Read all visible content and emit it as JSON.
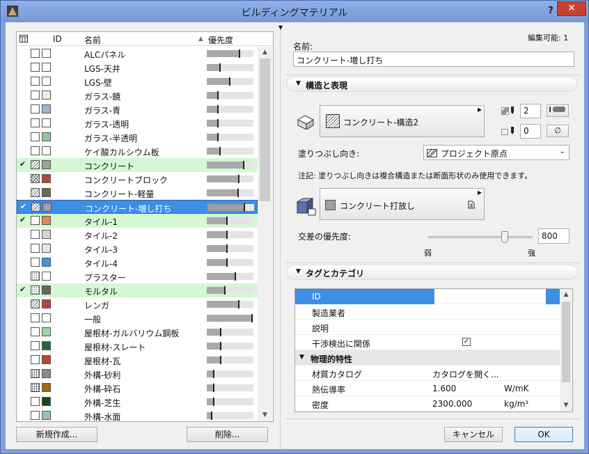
{
  "window": {
    "title": "ビルディングマテリアル",
    "help": "?",
    "close": "✕"
  },
  "list": {
    "headers": {
      "id": "ID",
      "name": "名前",
      "priority": "優先度",
      "sort_arrow": "▲"
    },
    "rows": [
      {
        "name": "ALCパネル",
        "check": "",
        "p1": "empty",
        "c2": "#ffffff",
        "priority": 0.72,
        "state": ""
      },
      {
        "name": "LGS-天井",
        "check": "",
        "p1": "empty",
        "c2": "#ffffff",
        "priority": 0.3,
        "state": ""
      },
      {
        "name": "LGS-壁",
        "check": "",
        "p1": "empty",
        "c2": "#ffffff",
        "priority": 0.5,
        "state": ""
      },
      {
        "name": "ガラス-鏡",
        "check": "",
        "p1": "empty",
        "c2": "#e8f0e0",
        "priority": 0.25,
        "state": ""
      },
      {
        "name": "ガラス-青",
        "check": "",
        "p1": "empty",
        "c2": "#9eb6d6",
        "priority": 0.25,
        "state": ""
      },
      {
        "name": "ガラス-透明",
        "check": "",
        "p1": "empty",
        "c2": "#ffffff",
        "priority": 0.25,
        "state": ""
      },
      {
        "name": "ガラス-半透明",
        "check": "",
        "p1": "empty",
        "c2": "#8fc79a",
        "priority": 0.25,
        "state": ""
      },
      {
        "name": "ケイ酸カルシウム板",
        "check": "",
        "p1": "empty",
        "c2": "#ffffff",
        "priority": 0.3,
        "state": ""
      },
      {
        "name": "コンクリート",
        "check": "✔",
        "p1": "hatch",
        "c2": "#a0a0a0",
        "priority": 0.8,
        "state": "green"
      },
      {
        "name": "コンクリートブロック",
        "check": "",
        "p1": "cross",
        "c2": "#b5483a",
        "priority": 0.7,
        "state": ""
      },
      {
        "name": "コンクリート-軽量",
        "check": "",
        "p1": "hatch",
        "c2": "#6a6a50",
        "priority": 0.68,
        "state": ""
      },
      {
        "name": "コンクリート-増し打ち",
        "check": "✔",
        "p1": "hatch",
        "c2": "#a0a0a0",
        "priority": 0.8,
        "state": "sel"
      },
      {
        "name": "タイル-1",
        "check": "✔",
        "p1": "empty",
        "c2": "#e48a4a",
        "priority": 0.45,
        "state": "green"
      },
      {
        "name": "タイル-2",
        "check": "",
        "p1": "empty",
        "c2": "#d7d7c6",
        "priority": 0.45,
        "state": ""
      },
      {
        "name": "タイル-3",
        "check": "",
        "p1": "empty",
        "c2": "#efe1e3",
        "priority": 0.45,
        "state": ""
      },
      {
        "name": "タイル-4",
        "check": "",
        "p1": "empty",
        "c2": "#3e95e4",
        "priority": 0.45,
        "state": ""
      },
      {
        "name": "プラスター",
        "check": "",
        "p1": "dots",
        "c2": "#ffffff",
        "priority": 0.62,
        "state": ""
      },
      {
        "name": "モルタル",
        "check": "✔",
        "p1": "dots",
        "c2": "#6a6a50",
        "priority": 0.4,
        "state": "green"
      },
      {
        "name": "レンガ",
        "check": "",
        "p1": "hatch",
        "c2": "#b5483a",
        "priority": 0.7,
        "state": ""
      },
      {
        "name": "一般",
        "check": "",
        "p1": "empty",
        "c2": "#ffffff",
        "priority": 0.98,
        "state": ""
      },
      {
        "name": "屋根材-ガルバリウム鋼板",
        "check": "",
        "p1": "empty",
        "c2": "#9bd6a4",
        "priority": 0.32,
        "state": ""
      },
      {
        "name": "屋根材-スレート",
        "check": "",
        "p1": "empty",
        "c2": "#1e6a3a",
        "priority": 0.32,
        "state": ""
      },
      {
        "name": "屋根材-瓦",
        "check": "",
        "p1": "empty",
        "c2": "#b5483a",
        "priority": 0.32,
        "state": ""
      },
      {
        "name": "外構-砂利",
        "check": "",
        "p1": "crossdots",
        "c2": "#8a8a8a",
        "priority": 0.16,
        "state": ""
      },
      {
        "name": "外構-砕石",
        "check": "",
        "p1": "crossdots",
        "c2": "#a8660e",
        "priority": 0.16,
        "state": ""
      },
      {
        "name": "外構-芝生",
        "check": "",
        "p1": "empty",
        "c2": "#174a17",
        "priority": 0.16,
        "state": ""
      },
      {
        "name": "外構-水面",
        "check": "",
        "p1": "empty",
        "c2": "#9fbfae",
        "priority": 0.12,
        "state": ""
      }
    ]
  },
  "buttons": {
    "new": "新規作成...",
    "delete": "削除...",
    "cancel": "キャンセル",
    "ok": "OK"
  },
  "right": {
    "editable_label": "編集可能: 1",
    "name_label": "名前:",
    "name_value": "コンクリート-増し打ち",
    "structure_section": "構造と表現",
    "structure_fill": "コンクリート-構造2",
    "pen1_value": "2",
    "pen2_value": "0",
    "fill_orientation_label": "塗りつぶし向き:",
    "fill_orientation_value": "プロジェクト原点",
    "note": "注記: 塗りつぶし向きは複合構造または断面形状のみ使用できます。",
    "surface_value": "コンクリート打放し",
    "priority_label": "交差の優先度:",
    "priority_value": "800",
    "slider_weak": "弱",
    "slider_strong": "強",
    "slider_level": 0.73,
    "tags_section": "タグとカテゴリ"
  },
  "tags": [
    {
      "key": "ID",
      "value": "",
      "unit": "",
      "type": "selected"
    },
    {
      "key": "製造業者",
      "value": "",
      "unit": "",
      "type": "row"
    },
    {
      "key": "説明",
      "value": "",
      "unit": "",
      "type": "row"
    },
    {
      "key": "干渉検出に関係",
      "value": "",
      "unit": "",
      "type": "check"
    },
    {
      "key": "物理的特性",
      "value": "",
      "unit": "",
      "type": "group"
    },
    {
      "key": "材質カタログ",
      "value": "カタログを開く...",
      "unit": "",
      "type": "row"
    },
    {
      "key": "熱伝導率",
      "value": "1.600",
      "unit": "W/mK",
      "type": "row"
    },
    {
      "key": "密度",
      "value": "2300.000",
      "unit": "kg/m³",
      "type": "row"
    }
  ]
}
